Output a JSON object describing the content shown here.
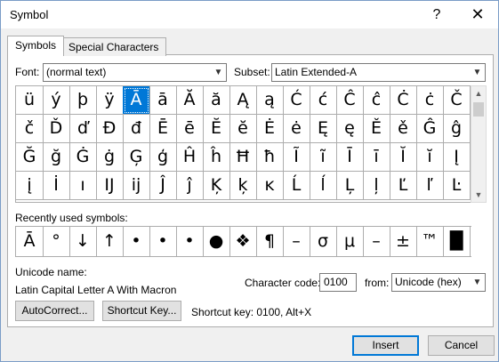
{
  "window": {
    "title": "Symbol",
    "help_icon": "?",
    "close_icon": "✕"
  },
  "tabs": [
    {
      "label": "Symbols",
      "active": true
    },
    {
      "label": "Special Characters",
      "active": false
    }
  ],
  "font": {
    "label": "Font:",
    "value": "(normal text)"
  },
  "subset": {
    "label": "Subset:",
    "value": "Latin Extended-A"
  },
  "symbols_grid": [
    [
      "ü",
      "ý",
      "þ",
      "ÿ",
      "Ā",
      "ā",
      "Ă",
      "ă",
      "Ą",
      "ą",
      "Ć",
      "ć",
      "Ĉ",
      "ĉ",
      "Ċ",
      "ċ",
      "Č"
    ],
    [
      "č",
      "Ď",
      "ď",
      "Đ",
      "đ",
      "Ē",
      "ē",
      "Ĕ",
      "ĕ",
      "Ė",
      "ė",
      "Ę",
      "ę",
      "Ě",
      "ě",
      "Ĝ",
      "ĝ"
    ],
    [
      "Ğ",
      "ğ",
      "Ġ",
      "ġ",
      "Ģ",
      "ģ",
      "Ĥ",
      "ĥ",
      "Ħ",
      "ħ",
      "Ĩ",
      "ĩ",
      "Ī",
      "ī",
      "Ĭ",
      "ĭ",
      "Į"
    ],
    [
      "į",
      "İ",
      "ı",
      "Ĳ",
      "ĳ",
      "Ĵ",
      "ĵ",
      "Ķ",
      "ķ",
      "ĸ",
      "Ĺ",
      "ĺ",
      "Ļ",
      "ļ",
      "Ľ",
      "ľ",
      "Ŀ"
    ]
  ],
  "selected": {
    "row": 0,
    "col": 4
  },
  "recently_used": {
    "label": "Recently used symbols:",
    "symbols": [
      "Ā",
      "°",
      "↓",
      "↑",
      "•",
      "•",
      "•",
      "●",
      "❖",
      "¶",
      "–",
      "σ",
      "μ",
      "–",
      "±",
      "™",
      "█"
    ]
  },
  "unicode_name": {
    "label": "Unicode name:",
    "value": "Latin Capital Letter A With Macron"
  },
  "character_code": {
    "label": "Character code:",
    "value": "0100"
  },
  "from": {
    "label": "from:",
    "value": "Unicode (hex)"
  },
  "buttons": {
    "autocorrect": "AutoCorrect...",
    "shortcut_key": "Shortcut Key...",
    "insert": "Insert",
    "cancel": "Cancel"
  },
  "shortcut_key_text": "Shortcut key: 0100, Alt+X"
}
